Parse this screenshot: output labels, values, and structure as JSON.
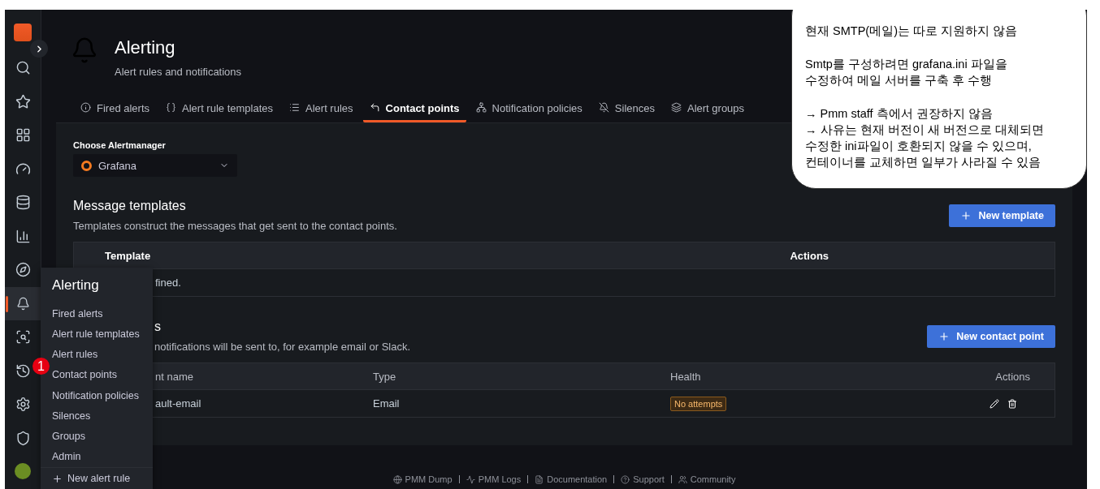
{
  "page_header": {
    "title": "Alerting",
    "subtitle": "Alert rules and notifications"
  },
  "tabs": [
    {
      "kind": "info",
      "label": "Fired alerts",
      "selected": false
    },
    {
      "kind": "braces",
      "label": "Alert rule templates",
      "selected": false
    },
    {
      "kind": "list",
      "label": "Alert rules",
      "selected": false
    },
    {
      "kind": "contact",
      "label": "Contact points",
      "selected": true
    },
    {
      "kind": "tree",
      "label": "Notification policies",
      "selected": false
    },
    {
      "kind": "mute",
      "label": "Silences",
      "selected": false
    },
    {
      "kind": "layers",
      "label": "Alert groups",
      "selected": false
    }
  ],
  "alertmanager": {
    "label": "Choose Alertmanager",
    "value": "Grafana"
  },
  "message_templates": {
    "title": "Message templates",
    "description": "Templates construct the messages that get sent to the contact points.",
    "button": "New template",
    "columns": [
      "Template",
      "Actions"
    ],
    "empty_text": "fined."
  },
  "contact_points": {
    "title": "s",
    "description": "notifications will be sent to, for example email or Slack.",
    "button": "New contact point",
    "columns": [
      "nt name",
      "Type",
      "Health",
      "Actions"
    ],
    "rows": [
      {
        "name": "ault-email",
        "type": "Email",
        "health": "No attempts"
      }
    ]
  },
  "nav_menu": {
    "title": "Alerting",
    "items": [
      "Fired alerts",
      "Alert rule templates",
      "Alert rules",
      "Contact points",
      "Notification policies",
      "Silences",
      "Groups",
      "Admin"
    ],
    "footer_item": "New alert rule"
  },
  "badge": "1",
  "footer_links": [
    "PMM Dump",
    "PMM Logs",
    "Documentation",
    "Support",
    "Community"
  ],
  "callout": {
    "paragraphs": [
      [
        "현재 SMTP(메일)는 따로 지원하지 않음"
      ],
      [
        "Smtp를 구성하려면 grafana.ini 파일을",
        "수정하여 메일 서버를 구축 후 수행"
      ],
      [
        "→ Pmm staff 측에서 권장하지 않음",
        "→ 사유는 현재 버전이 새 버전으로 대체되면",
        "수정한 ini파일이 호환되지 않을 수 있으며,",
        "컨테이너를 교체하면 일부가 사라질 수 있음"
      ]
    ]
  }
}
